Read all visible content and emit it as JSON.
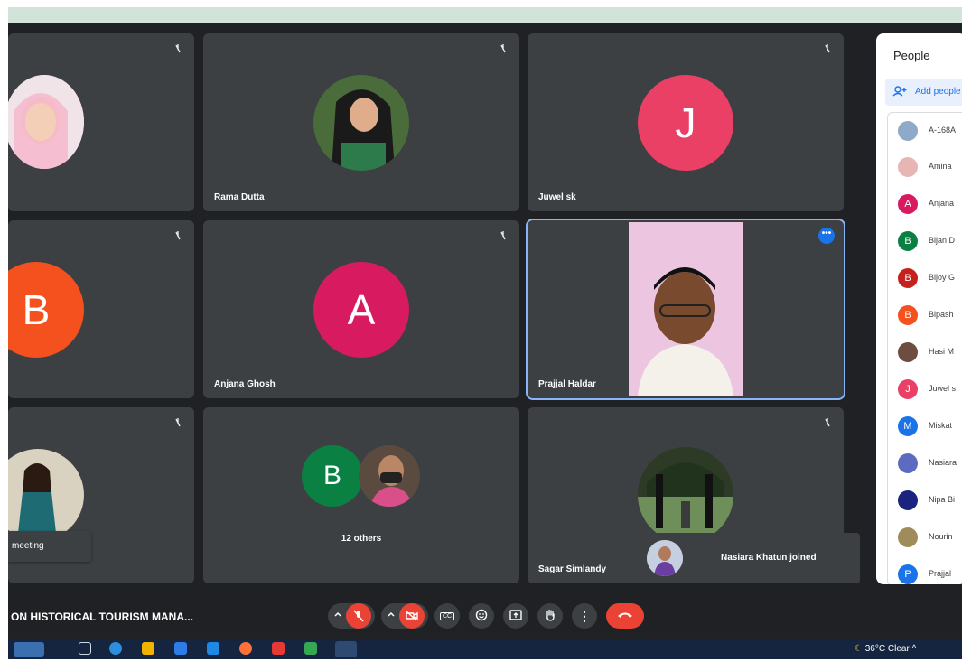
{
  "colors": {
    "tile_bg": "#3c4043",
    "screen_bg": "#202124",
    "accent_blue": "#1a73e8",
    "red": "#ea4335"
  },
  "tiles": {
    "t1": {
      "name": "",
      "avatar_type": "photo"
    },
    "t2": {
      "name": "Rama Dutta",
      "avatar_type": "photo"
    },
    "t3": {
      "name": "Juwel sk",
      "initial": "J",
      "color": "#ea4066"
    },
    "t4": {
      "name": "",
      "initial": "B",
      "color": "#f4511e"
    },
    "t5": {
      "name": "Anjana Ghosh",
      "initial": "A",
      "color": "#d81b60"
    },
    "t6": {
      "name": "Prajjal Haldar",
      "avatar_type": "video"
    },
    "t7": {
      "name": "",
      "avatar_type": "photo"
    },
    "t8": {
      "name": "12 others",
      "initial": "B",
      "color": "#0b8043"
    },
    "t9": {
      "name": "Sagar Simlandy",
      "avatar_type": "photo"
    }
  },
  "left_toast": {
    "text": "meeting"
  },
  "toast": {
    "text": "Nasiara Khatun joined"
  },
  "people_panel": {
    "title": "People",
    "add_label": "Add people",
    "list": [
      {
        "name": "A-168A",
        "initial": "",
        "color": "#8fa9c9"
      },
      {
        "name": "Amina",
        "initial": "",
        "color": "#e8b5b5"
      },
      {
        "name": "Anjana",
        "initial": "A",
        "color": "#d81b60"
      },
      {
        "name": "Bijan D",
        "initial": "B",
        "color": "#0b8043"
      },
      {
        "name": "Bijoy G",
        "initial": "B",
        "color": "#c5221f"
      },
      {
        "name": "Bipash",
        "initial": "B",
        "color": "#f4511e"
      },
      {
        "name": "Hasi M",
        "initial": "",
        "color": "#6d4c41"
      },
      {
        "name": "Juwel s",
        "initial": "J",
        "color": "#ea4066"
      },
      {
        "name": "Miskat",
        "initial": "M",
        "color": "#1a73e8"
      },
      {
        "name": "Nasiara",
        "initial": "",
        "color": "#5c6bc0"
      },
      {
        "name": "Nipa Bi",
        "initial": "",
        "color": "#1a237e"
      },
      {
        "name": "Nourin",
        "initial": "",
        "color": "#9e8c5a"
      },
      {
        "name": "Prajjal",
        "initial": "P",
        "color": "#1a73e8"
      }
    ]
  },
  "meeting": {
    "title": "ON HISTORICAL TOURISM MANA..."
  },
  "controls": {
    "captions": "CC",
    "more": "⋮"
  },
  "taskbar": {
    "weather": "36°C  Clear"
  }
}
